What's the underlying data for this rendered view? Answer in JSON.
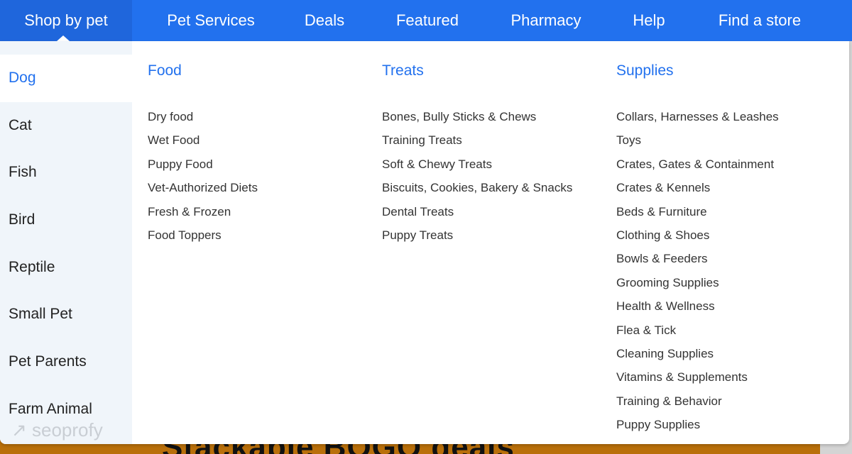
{
  "nav": [
    "Shop by pet",
    "Pet Services",
    "Deals",
    "Featured",
    "Pharmacy",
    "Help",
    "Find a store"
  ],
  "pets": [
    "Dog",
    "Cat",
    "Fish",
    "Bird",
    "Reptile",
    "Small Pet",
    "Pet Parents",
    "Farm Animal"
  ],
  "selected_pet": "Dog",
  "columns": [
    {
      "title": "Food",
      "items": [
        "Dry food",
        "Wet Food",
        "Puppy Food",
        "Vet-Authorized Diets",
        "Fresh & Frozen",
        "Food Toppers"
      ]
    },
    {
      "title": "Treats",
      "items": [
        "Bones, Bully Sticks & Chews",
        "Training Treats",
        "Soft & Chewy Treats",
        "Biscuits, Cookies, Bakery & Snacks",
        "Dental Treats",
        "Puppy Treats"
      ]
    },
    {
      "title": "Supplies",
      "items": [
        "Collars, Harnesses & Leashes",
        "Toys",
        "Crates, Gates & Containment",
        "Crates & Kennels",
        "Beds & Furniture",
        "Clothing & Shoes",
        "Bowls & Feeders",
        "Grooming Supplies",
        "Health & Wellness",
        "Flea & Tick",
        "Cleaning Supplies",
        "Vitamins & Supplements",
        "Training & Behavior",
        "Puppy Supplies"
      ]
    }
  ],
  "banner": "Stackable BOGO deals",
  "watermark": "↗ seoprofy",
  "colors": {
    "brand": "#2271ee",
    "sidebar": "#f0f5fa",
    "banner": "#b96f0a"
  }
}
